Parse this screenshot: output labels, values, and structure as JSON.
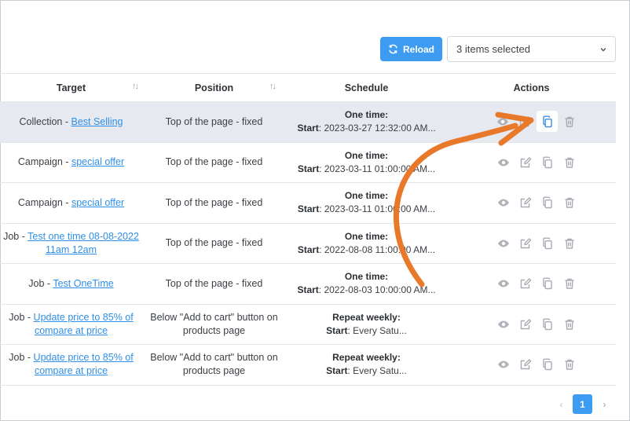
{
  "toolbar": {
    "reload_label": "Reload",
    "selection_text": "3 items selected"
  },
  "columns": {
    "target": "Target",
    "position": "Position",
    "schedule": "Schedule",
    "actions": "Actions"
  },
  "rows": [
    {
      "type": "Collection",
      "sep": " - ",
      "link": "Best Selling",
      "position": "Top of the page - fixed",
      "sched_title": "One time:",
      "start_label": "Start",
      "start_value": ": 2023-03-27 12:32:00 AM..."
    },
    {
      "type": "Campaign",
      "sep": " - ",
      "link": "special offer",
      "position": "Top of the page - fixed",
      "sched_title": "One time:",
      "start_label": "Start",
      "start_value": ": 2023-03-11 01:00:00 AM..."
    },
    {
      "type": "Campaign",
      "sep": " - ",
      "link": "special offer",
      "position": "Top of the page - fixed",
      "sched_title": "One time:",
      "start_label": "Start",
      "start_value": ": 2023-03-11 01:00:00 AM..."
    },
    {
      "type": "Job",
      "sep": " - ",
      "link": "Test one time 08-08-2022 11am 12am",
      "position": "Top of the page - fixed",
      "sched_title": "One time:",
      "start_label": "Start",
      "start_value": ": 2022-08-08 11:00:00 AM..."
    },
    {
      "type": "Job",
      "sep": " - ",
      "link": "Test OneTime",
      "position": "Top of the page - fixed",
      "sched_title": "One time:",
      "start_label": "Start",
      "start_value": ": 2022-08-03 10:00:00 AM..."
    },
    {
      "type": "Job",
      "sep": " - ",
      "link": "Update price to 85% of compare at price",
      "position": "Below \"Add to cart\" button on products page",
      "sched_title": "Repeat weekly:",
      "start_label": "Start",
      "start_value": ": Every Satu..."
    },
    {
      "type": "Job",
      "sep": " - ",
      "link": "Update price to 85% of compare at price",
      "position": "Below \"Add to cart\" button on products page",
      "sched_title": "Repeat weekly:",
      "start_label": "Start",
      "start_value": ": Every Satu..."
    }
  ],
  "icons": {
    "reload": "refresh-icon",
    "sort": "sort-icon",
    "view": "eye-icon",
    "edit": "edit-icon",
    "duplicate": "copy-icon",
    "delete": "trash-icon",
    "dropdown": "chevron-down-icon"
  },
  "pagination": {
    "prev": "‹",
    "current": "1",
    "next": "›"
  },
  "colors": {
    "accent": "#3d9bf2",
    "link": "#2f8fe6",
    "selected_row": "#e7e9f0",
    "annotation_arrow": "#e8782a",
    "icon_gray": "#a9adb3",
    "copy_highlight": "#3d8fe0"
  }
}
